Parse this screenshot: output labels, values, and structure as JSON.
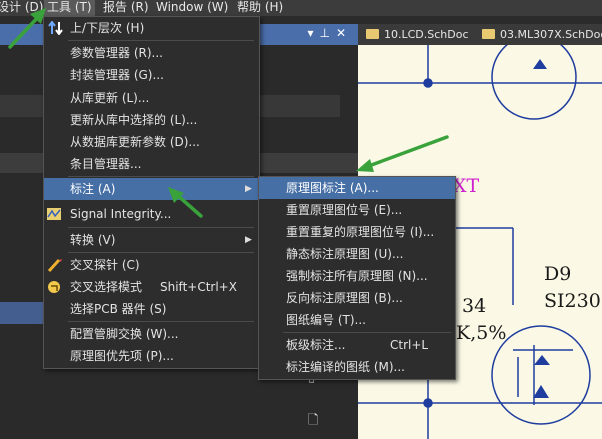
{
  "menubar": {
    "items": [
      {
        "label": "设计 (D)"
      },
      {
        "label": "工具 (T)"
      },
      {
        "label": "报告 (R)"
      },
      {
        "label": "Window (W)"
      },
      {
        "label": "帮助 (H)"
      }
    ]
  },
  "tabs": [
    {
      "label": "10.LCD.SchDoc"
    },
    {
      "label": "03.ML307X.SchDoc"
    }
  ],
  "tools_menu": {
    "items": [
      {
        "label": "上/下层次 (H)",
        "icon": "up-down-arrows-icon"
      },
      {
        "label": "参数管理器 (R)..."
      },
      {
        "label": "封装管理器 (G)..."
      },
      {
        "label": "从库更新 (L)..."
      },
      {
        "label": "更新从库中选择的 (L)..."
      },
      {
        "label": "从数据库更新参数 (D)..."
      },
      {
        "label": "条目管理器..."
      },
      {
        "label": "标注 (A)",
        "submenu": true
      },
      {
        "label": "Signal Integrity...",
        "icon": "signal-integrity-icon"
      },
      {
        "label": "转换 (V)",
        "submenu": true
      },
      {
        "label": "交叉探针 (C)",
        "icon": "cross-probe-icon"
      },
      {
        "label": "交叉选择模式",
        "shortcut": "Shift+Ctrl+X",
        "icon": "cross-select-icon"
      },
      {
        "label": "选择PCB 器件 (S)"
      },
      {
        "label": "配置管脚交换 (W)..."
      },
      {
        "label": "原理图优先项 (P)..."
      }
    ]
  },
  "annotate_submenu": {
    "items": [
      {
        "label": "原理图标注 (A)..."
      },
      {
        "label": "重置原理图位号 (E)..."
      },
      {
        "label": "重置重复的原理图位号 (I)..."
      },
      {
        "label": "静态标注原理图 (U)..."
      },
      {
        "label": "强制标注所有原理图 (N)..."
      },
      {
        "label": "反向标注原理图 (B)..."
      },
      {
        "label": "图纸编号 (T)..."
      },
      {
        "label": "板级标注...",
        "shortcut": "Ctrl+L"
      },
      {
        "label": "标注编译的图纸 (M)..."
      }
    ]
  },
  "schematic": {
    "labels": {
      "xt": "XT",
      "d9": "D9",
      "si": "SI230",
      "r34": "34",
      "kval": "K,5%"
    }
  },
  "colors": {
    "menu_highlight": "#466fa5",
    "panel_titlebar": "#4a6eaa",
    "schematic_wire": "#1f3d9e",
    "annotation_arrow": "#3aa23a",
    "net_label": "#d020d0"
  }
}
